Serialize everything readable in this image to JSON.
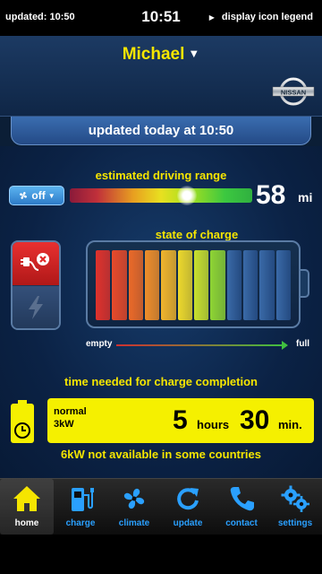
{
  "status_bar": {
    "updated": "updated: 10:50",
    "time": "10:51",
    "legend_link": "display icon legend"
  },
  "header": {
    "user_name": "Michael",
    "brand": "NISSAN"
  },
  "updated_banner": "updated today at 10:50",
  "range": {
    "label": "estimated driving range",
    "value": "58",
    "unit": "mi",
    "climate_toggle": "off",
    "level_fraction": 0.64
  },
  "charge": {
    "label": "state of charge",
    "cells_total": 12,
    "cells_filled": 8,
    "cell_colors": [
      "#e0322c",
      "#e84a2a",
      "#ec6a28",
      "#ef8e2a",
      "#f0b42c",
      "#ecd82c",
      "#c8e02e",
      "#8ed434",
      "#2f5e9a",
      "#2f5e9a",
      "#2f5e9a",
      "#2f5e9a"
    ],
    "empty_label": "empty",
    "full_label": "full"
  },
  "charge_time": {
    "label": "time needed for charge completion",
    "mode_line1": "normal",
    "mode_line2": "3kW",
    "hours": "5",
    "hours_unit": "hours",
    "minutes": "30",
    "minutes_unit": "min.",
    "note": "6kW not available in some countries"
  },
  "tabs": [
    {
      "label": "home",
      "icon": "home-icon"
    },
    {
      "label": "charge",
      "icon": "charge-icon"
    },
    {
      "label": "climate",
      "icon": "fan-icon"
    },
    {
      "label": "update",
      "icon": "refresh-icon"
    },
    {
      "label": "contact",
      "icon": "phone-icon"
    },
    {
      "label": "settings",
      "icon": "gears-icon"
    }
  ],
  "colors": {
    "accent_yellow": "#f5e500",
    "tab_blue": "#2aa0ff",
    "plug_red": "#e83030"
  }
}
